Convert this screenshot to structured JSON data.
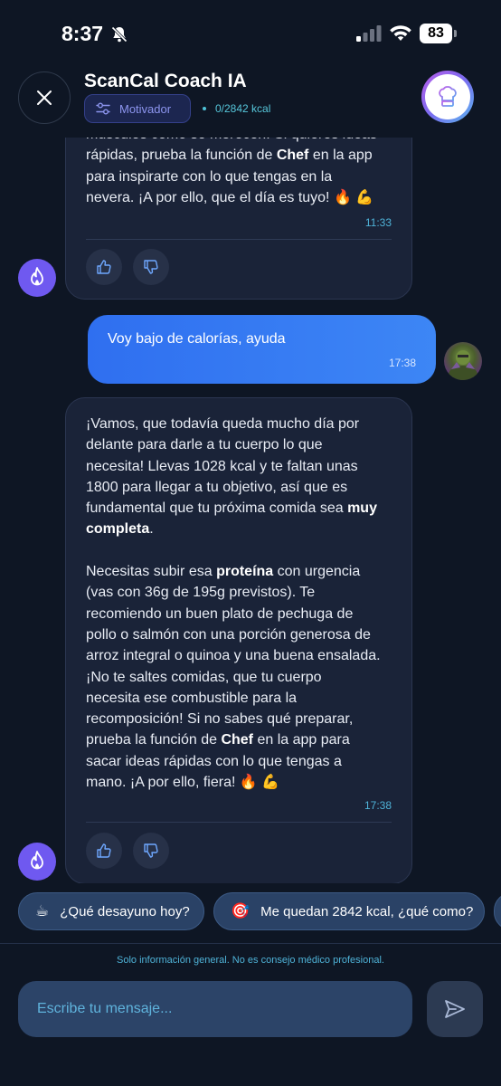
{
  "status_bar": {
    "time": "8:37",
    "battery": "83"
  },
  "header": {
    "title": "ScanCal Coach IA",
    "mode_label": "Motivador",
    "kcal": "0/2842 kcal"
  },
  "messages": [
    {
      "role": "assistant",
      "lines": [
        "músculos como se merecen. Si quieres ideas",
        [
          "rápidas, prueba la función de ",
          {
            "b": "Chef"
          },
          " en la app"
        ],
        "para inspirarte con lo que tengas en la",
        "nevera. ¡A por ello, que el día es tuyo! 🔥 💪"
      ],
      "time": "11:33"
    },
    {
      "role": "user",
      "text": "Voy bajo de calorías, ayuda",
      "time": "17:38"
    },
    {
      "role": "assistant",
      "lines": [
        "¡Vamos, que todavía queda mucho día por",
        "delante para darle a tu cuerpo lo que",
        "necesita! Llevas 1028 kcal y te faltan unas",
        "1800 para llegar a tu objetivo, así que es",
        [
          "fundamental que tu próxima comida sea ",
          {
            "b": "muy"
          }
        ],
        [
          {
            "b": "completa"
          },
          "."
        ],
        "",
        [
          "Necesitas subir esa ",
          {
            "b": "proteína"
          },
          " con urgencia"
        ],
        "(vas con 36g de 195g previstos). Te",
        "recomiendo un buen plato de pechuga de",
        "pollo o salmón con una porción generosa de",
        "arroz integral o quinoa y una buena ensalada.",
        "¡No te saltes comidas, que tu cuerpo",
        "necesita ese combustible para la",
        "recomposición! Si no sabes qué preparar,",
        [
          "prueba la función de ",
          {
            "b": "Chef"
          },
          " en la app para"
        ],
        "sacar ideas rápidas con lo que tengas a",
        "mano. ¡A por ello, fiera! 🔥 💪"
      ],
      "time": "17:38"
    }
  ],
  "suggestions": [
    {
      "emoji": "☕",
      "label": "¿Qué desayuno hoy?"
    },
    {
      "emoji": "🎯",
      "label": "Me quedan 2842 kcal, ¿qué como?"
    }
  ],
  "footer": {
    "disclaimer": "Solo información general. No es consejo médico profesional.",
    "input_placeholder": "Escribe tu mensaje..."
  }
}
